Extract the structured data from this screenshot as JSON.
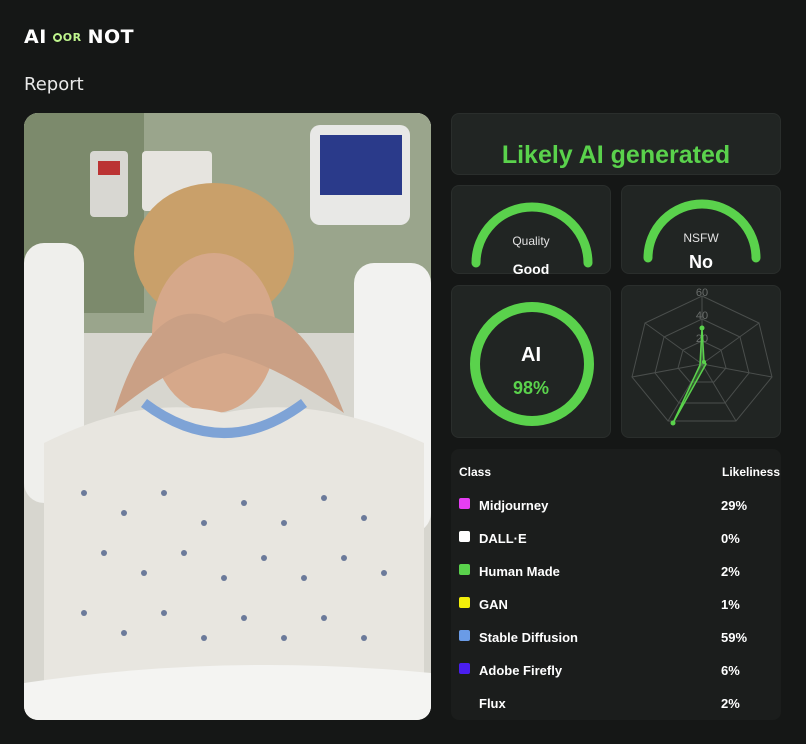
{
  "header": {
    "logo_left": "AI",
    "logo_mid": "OR",
    "logo_right": "NOT",
    "section_title": "Report"
  },
  "verdict": {
    "text": "Likely AI generated",
    "color": "#5ad24c"
  },
  "quality": {
    "label": "Quality",
    "value": "Good"
  },
  "nsfw": {
    "label": "NSFW",
    "value": "No"
  },
  "ai_score": {
    "label": "AI",
    "value": "98%",
    "fraction": 0.98
  },
  "radar": {
    "tick_labels": [
      "20",
      "40",
      "60"
    ]
  },
  "table": {
    "col_class": "Class",
    "col_likeliness": "Likeliness",
    "rows": [
      {
        "name": "Midjourney",
        "pct": "29%",
        "color": "#e63ef3"
      },
      {
        "name": "DALL·E",
        "pct": "0%",
        "color": "#ffffff"
      },
      {
        "name": "Human Made",
        "pct": "2%",
        "color": "#5ad24c"
      },
      {
        "name": "GAN",
        "pct": "1%",
        "color": "#f2ee0a"
      },
      {
        "name": "Stable Diffusion",
        "pct": "59%",
        "color": "#6a9be6"
      },
      {
        "name": "Adobe Firefly",
        "pct": "6%",
        "color": "#4a1ef0"
      },
      {
        "name": "Flux",
        "pct": "2%",
        "color": ""
      }
    ]
  },
  "colors": {
    "accent": "#5ad24c",
    "background": "#151716",
    "card": "#212523"
  }
}
